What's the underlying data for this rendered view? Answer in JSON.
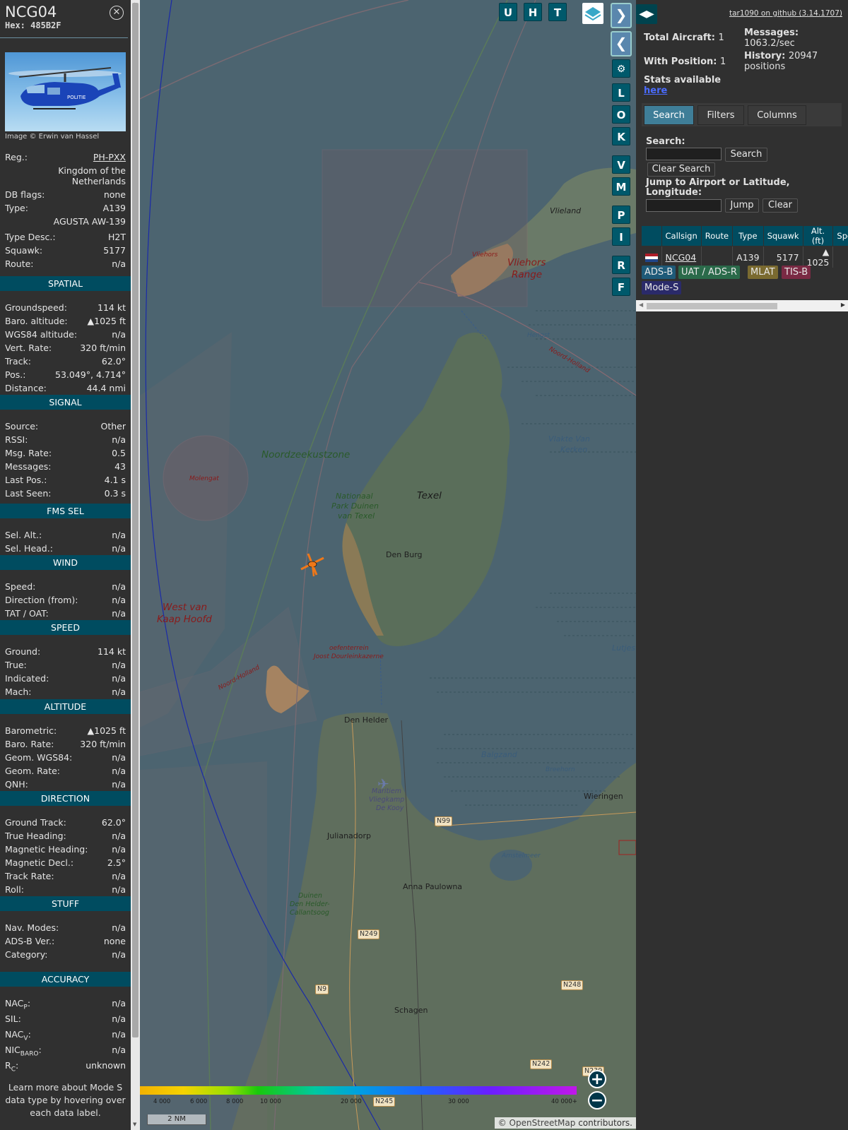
{
  "aircraft": {
    "callsign": "NCG04",
    "hex_label": "Hex:",
    "hex": "485B2F",
    "photo_caption": "Image © Erwin van Hassel",
    "reg_label": "Reg.:",
    "reg": "PH-PXX",
    "country": "Kingdom of the Netherlands",
    "db_flags_label": "DB flags:",
    "db_flags": "none",
    "type_label": "Type:",
    "type": "A139",
    "type_name": "AGUSTA AW-139",
    "type_desc_label": "Type Desc.:",
    "type_desc": "H2T",
    "squawk_label": "Squawk:",
    "squawk": "5177",
    "route_label": "Route:",
    "route": "n/a"
  },
  "sections": {
    "spatial": "SPATIAL",
    "signal": "SIGNAL",
    "fms": "FMS SEL",
    "wind": "WIND",
    "speed": "SPEED",
    "altitude": "ALTITUDE",
    "direction": "DIRECTION",
    "stuff": "STUFF",
    "accuracy": "ACCURACY"
  },
  "spatial": [
    {
      "k": "Groundspeed:",
      "v": "114 kt"
    },
    {
      "k": "Baro. altitude:",
      "v": "▲1025 ft"
    },
    {
      "k": "WGS84 altitude:",
      "v": "n/a"
    },
    {
      "k": "Vert. Rate:",
      "v": "320 ft/min"
    },
    {
      "k": "Track:",
      "v": "62.0°"
    },
    {
      "k": "Pos.:",
      "v": "53.049°, 4.714°"
    },
    {
      "k": "Distance:",
      "v": "44.4 nmi"
    }
  ],
  "signal": [
    {
      "k": "Source:",
      "v": "Other"
    },
    {
      "k": "RSSI:",
      "v": "n/a"
    },
    {
      "k": "Msg. Rate:",
      "v": "0.5"
    },
    {
      "k": "Messages:",
      "v": "43"
    },
    {
      "k": "Last Pos.:",
      "v": "4.1 s"
    },
    {
      "k": "Last Seen:",
      "v": "0.3 s"
    }
  ],
  "fms": [
    {
      "k": "Sel. Alt.:",
      "v": "n/a"
    },
    {
      "k": "Sel. Head.:",
      "v": "n/a"
    }
  ],
  "wind": [
    {
      "k": "Speed:",
      "v": "n/a"
    },
    {
      "k": "Direction (from):",
      "v": "n/a"
    },
    {
      "k": "TAT / OAT:",
      "v": "n/a"
    }
  ],
  "speed": [
    {
      "k": "Ground:",
      "v": "114 kt"
    },
    {
      "k": "True:",
      "v": "n/a"
    },
    {
      "k": "Indicated:",
      "v": "n/a"
    },
    {
      "k": "Mach:",
      "v": "n/a"
    }
  ],
  "altitude": [
    {
      "k": "Barometric:",
      "v": "▲1025 ft"
    },
    {
      "k": "Baro. Rate:",
      "v": "320 ft/min"
    },
    {
      "k": "Geom. WGS84:",
      "v": "n/a"
    },
    {
      "k": "Geom. Rate:",
      "v": "n/a"
    },
    {
      "k": "QNH:",
      "v": "n/a"
    }
  ],
  "direction": [
    {
      "k": "Ground Track:",
      "v": "62.0°"
    },
    {
      "k": "True Heading:",
      "v": "n/a"
    },
    {
      "k": "Magnetic Heading:",
      "v": "n/a"
    },
    {
      "k": "Magnetic Decl.:",
      "v": "2.5°"
    },
    {
      "k": "Track Rate:",
      "v": "n/a"
    },
    {
      "k": "Roll:",
      "v": "n/a"
    }
  ],
  "stuff": [
    {
      "k": "Nav. Modes:",
      "v": "n/a"
    },
    {
      "k": "ADS-B Ver.:",
      "v": "none"
    },
    {
      "k": "Category:",
      "v": "n/a"
    }
  ],
  "accuracy": [
    {
      "k": "NAC",
      "sub": "P",
      "v": "n/a"
    },
    {
      "k": "SIL:",
      "sub": "",
      "v": "n/a"
    },
    {
      "k": "NAC",
      "sub": "V",
      "v": "n/a"
    },
    {
      "k": "NIC",
      "sub": "BARO",
      "v": "n/a"
    },
    {
      "k": "R",
      "sub": "C",
      "v": "unknown"
    }
  ],
  "learn_more": "Learn more about Mode S data type by hovering over each data label.",
  "map": {
    "buttons_top": [
      "U",
      "H",
      "T"
    ],
    "buttons_side": [
      "L",
      "O",
      "K",
      "V",
      "M",
      "P",
      "I",
      "R",
      "F"
    ],
    "labels": {
      "vlieland": "Vlieland",
      "vliehors": "Vliehors",
      "vliehors_range_1": "Vliehors",
      "vliehors_range_2": "Range",
      "hengst": "Hengst",
      "noord_holland_1": "Noord-Holland",
      "noord_holland_2": "Noord-Holland",
      "noordzeekustzone": "Noordzeekustzone",
      "molengat": "Molengat",
      "texel": "Texel",
      "np_1": "Nationaal",
      "np_2": "Park Duinen",
      "np_3": "van Texel",
      "den_burg": "Den Burg",
      "vlakte_1": "Vlakte Van",
      "vlakte_2": "Kerken",
      "west_1": "West van",
      "west_2": "Kaap Hoofd",
      "oefen_1": "oefenterrein",
      "oefen_2": "Joost Dourleinkazerne",
      "lutjes": "Lutjes",
      "den_helder": "Den Helder",
      "balgzand": "Balgzand",
      "breehorn": "Breehorn",
      "wieringen": "Wieringen",
      "maritiem_1": "Maritiem",
      "maritiem_2": "Vliegkamp",
      "maritiem_3": "De Kooy",
      "julianadorp": "Julianadorp",
      "amstelmeer": "Amstelmeer",
      "anna": "Anna Paulowna",
      "duinen_1": "Duinen",
      "duinen_2": "Den Helder-",
      "duinen_3": "Callantsoog",
      "schagen": "Schagen",
      "n99": "N99",
      "n249": "N249",
      "n248": "N248",
      "n9": "N9",
      "n242": "N242",
      "n245": "N245",
      "n239": "N239"
    },
    "altitude_ticks": [
      "4 000",
      "6 000",
      "8 000",
      "10 000",
      "20 000",
      "30 000",
      "40 000+"
    ],
    "scale": "2 NM",
    "attribution_prefix": "© ",
    "attribution_link": "OpenStreetMap",
    "attribution_suffix": " contributors."
  },
  "right": {
    "github": "tar1090 on github (3.14.1707)",
    "total_label": "Total Aircraft:",
    "total": "1",
    "withpos_label": "With Position:",
    "withpos": "1",
    "messages_label": "Messages:",
    "messages": "1063.2/sec",
    "history_label": "History:",
    "history": "20947 positions",
    "stats_label": "Stats available",
    "stats_link": "here",
    "tabs": [
      "Search",
      "Filters",
      "Columns"
    ],
    "search_label": "Search:",
    "search_button": "Search",
    "clear_search_button": "Clear Search",
    "jump_label": "Jump to Airport or Latitude, Longitude:",
    "jump_button": "Jump",
    "clear_button": "Clear",
    "table_headers": [
      "Callsign",
      "Route",
      "Type",
      "Squawk",
      "Alt. (ft)",
      "Spd"
    ],
    "table_rows": [
      {
        "callsign": "NCG04",
        "route": "",
        "type": "A139",
        "squawk": "5177",
        "alt": "▲ 1025",
        "spd": ""
      }
    ],
    "sources": [
      "ADS-B",
      "UAT / ADS-R",
      "MLAT",
      "TIS-B",
      "Mode-S"
    ]
  },
  "colors": {
    "section_header": "#004c60",
    "map_sea": "#4c6470",
    "aircraft_icon": "#f07818",
    "adsb": "#1e5a78",
    "uat": "#2a6a4a",
    "mlat": "#7a6a30",
    "tisb": "#7a2a44",
    "modes": "#2a2a6a"
  }
}
